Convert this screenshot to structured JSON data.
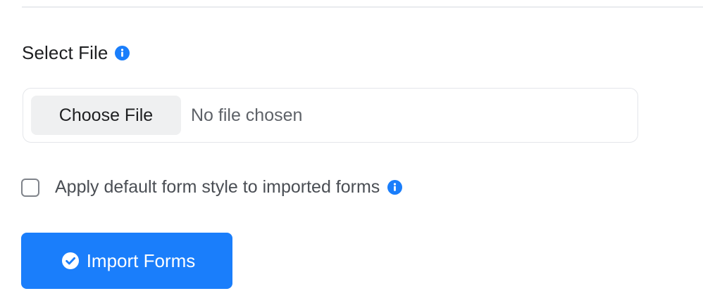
{
  "select_file": {
    "label": "Select File",
    "info_icon": "info-icon",
    "choose_button_label": "Choose File",
    "file_status": "No file chosen"
  },
  "options": {
    "apply_default_style_label": "Apply default form style to imported forms",
    "apply_default_style_checked": false,
    "info_icon": "info-icon"
  },
  "actions": {
    "import_button_label": "Import Forms",
    "import_button_icon": "check-circle-icon"
  },
  "colors": {
    "accent": "#1a7efb",
    "info_icon": "#1a7efb",
    "choose_button_bg": "#eff0f1",
    "border": "#e4e6ea"
  }
}
